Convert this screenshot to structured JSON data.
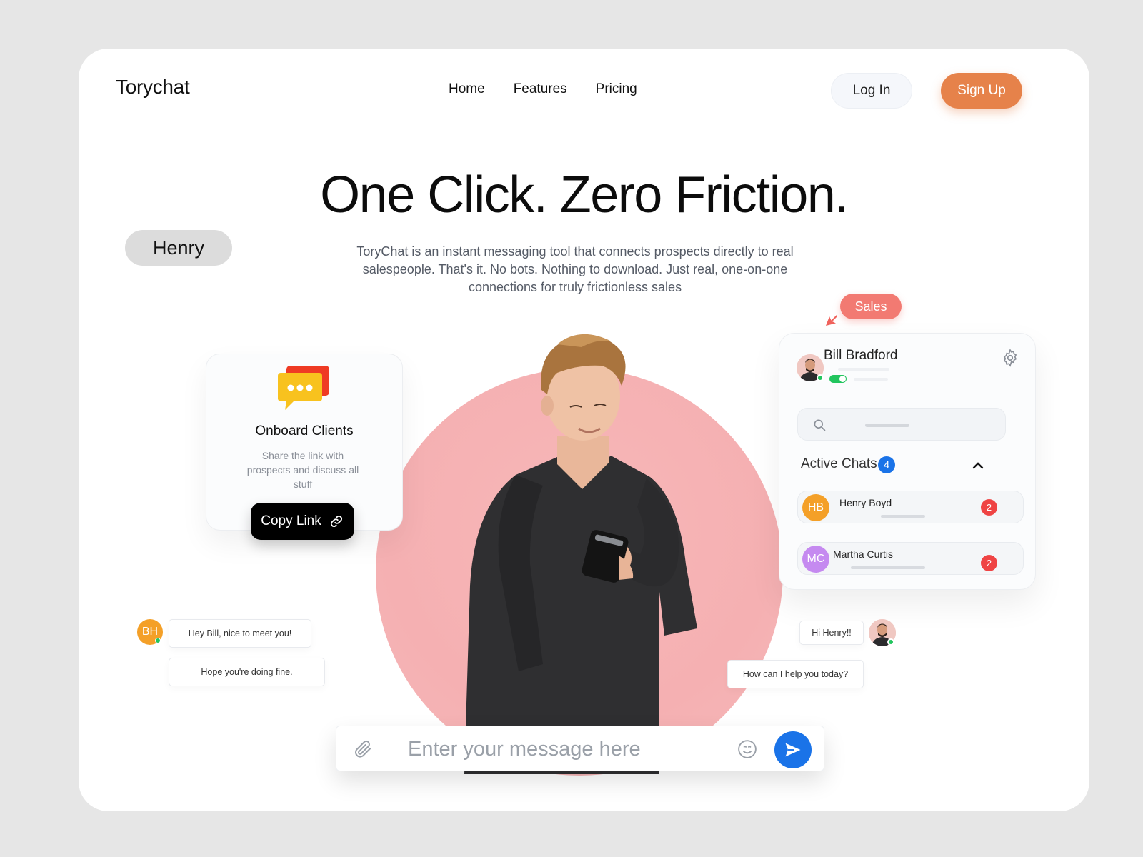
{
  "brand": "Torychat",
  "nav": {
    "home": "Home",
    "features": "Features",
    "pricing": "Pricing"
  },
  "auth": {
    "login": "Log In",
    "signup": "Sign Up"
  },
  "hero": {
    "title": "One Click. Zero Friction.",
    "subtitle": "ToryChat is an instant messaging tool that connects prospects directly to real salespeople. That's it. No bots. Nothing to download. Just real, one-on-one connections for truly frictionless sales"
  },
  "tags": {
    "henry": "Henry",
    "sales": "Sales"
  },
  "onboard": {
    "title": "Onboard Clients",
    "description": "Share the link with prospects and discuss all stuff",
    "copy_button": "Copy Link"
  },
  "panel": {
    "user_name": "Bill Bradford",
    "active_label": "Active Chats",
    "active_count": "4",
    "chats": [
      {
        "initials": "HB",
        "name": "Henry Boyd",
        "unread": "2",
        "color": "#f4a028"
      },
      {
        "initials": "MC",
        "name": "Martha Curtis",
        "unread": "2",
        "color": "#c58af0"
      }
    ]
  },
  "conversation": {
    "visitor_initials": "BH",
    "visitor_messages": [
      "Hey Bill, nice to meet you!",
      "Hope you're doing fine."
    ],
    "agent_messages": [
      "Hi Henry!!",
      "How can I help you today?"
    ]
  },
  "composer": {
    "placeholder": "Enter your message here"
  },
  "colors": {
    "accent": "#e6824a",
    "blue": "#1a73e8",
    "pink": "#f5b0b2",
    "sales": "#f27a72"
  },
  "icons": [
    "settings-gear-icon",
    "search-icon",
    "chevron-up-icon",
    "link-icon",
    "paperclip-icon",
    "smiley-icon",
    "send-icon"
  ]
}
